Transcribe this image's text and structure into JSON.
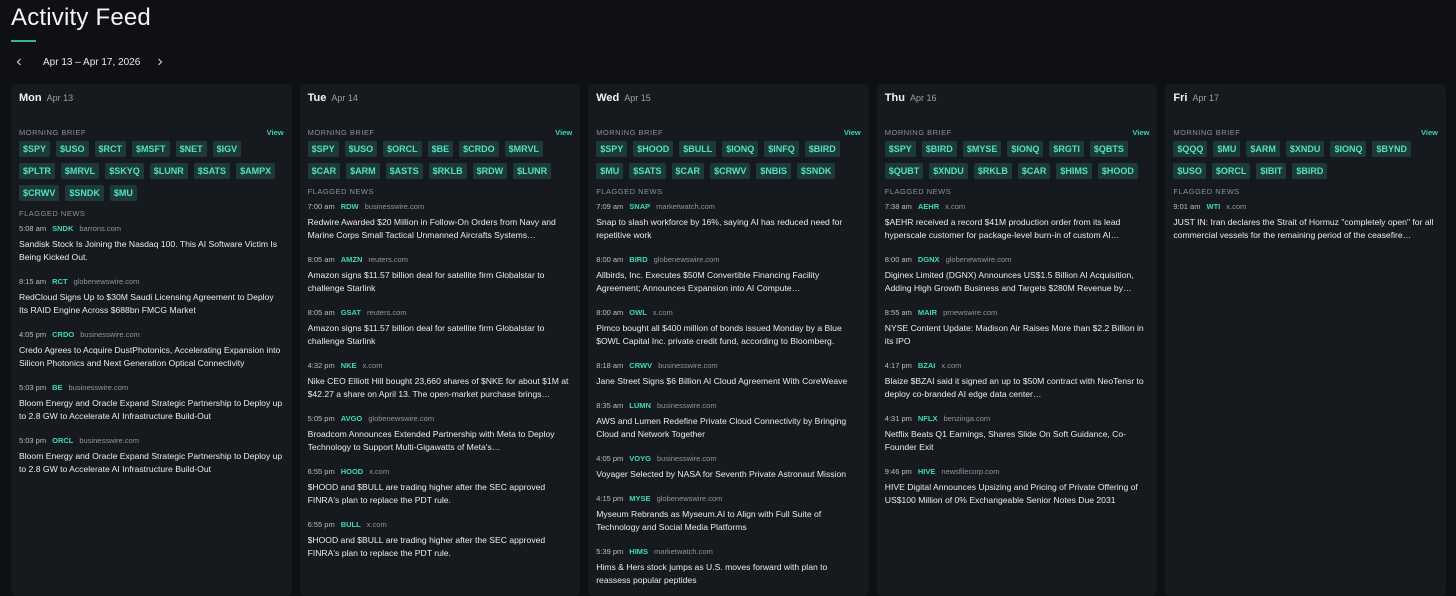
{
  "page": {
    "title": "Activity Feed"
  },
  "range": {
    "label": "Apr 13 – Apr 17, 2026"
  },
  "labels": {
    "morning_brief": "MORNING BRIEF",
    "flagged_news": "FLAGGED NEWS",
    "view": "View"
  },
  "colors": {
    "accent": "#35d6b4",
    "chip_bg": "#1d3a3b",
    "panel": "#161a1f",
    "background": "#0e1013"
  },
  "days": [
    {
      "day": "Mon",
      "date": "Apr 13",
      "tickers": [
        "$SPY",
        "$USO",
        "$RCT",
        "$MSFT",
        "$NET",
        "$IGV",
        "$PLTR",
        "$MRVL",
        "$SKYQ",
        "$LUNR",
        "$SATS",
        "$AMPX",
        "$CRWV",
        "$SNDK",
        "$MU"
      ],
      "news": [
        {
          "time": "5:08 am",
          "ticker": "SNDK",
          "source": "barrons.com",
          "text": "Sandisk Stock Is Joining the Nasdaq 100. This AI Software Victim Is Being Kicked Out."
        },
        {
          "time": "8:15 am",
          "ticker": "RCT",
          "source": "globenewswire.com",
          "text": "RedCloud Signs Up to $30M Saudi Licensing Agreement to Deploy Its RAID Engine Across $688bn FMCG Market"
        },
        {
          "time": "4:05 pm",
          "ticker": "CRDO",
          "source": "businesswire.com",
          "text": "Credo Agrees to Acquire DustPhotonics, Accelerating Expansion into Silicon Photonics and Next Generation Optical Connectivity"
        },
        {
          "time": "5:03 pm",
          "ticker": "BE",
          "source": "businesswire.com",
          "text": "Bloom Energy and Oracle Expand Strategic Partnership to Deploy up to 2.8 GW to Accelerate AI Infrastructure Build-Out"
        },
        {
          "time": "5:03 pm",
          "ticker": "ORCL",
          "source": "businesswire.com",
          "text": "Bloom Energy and Oracle Expand Strategic Partnership to Deploy up to 2.8 GW to Accelerate AI Infrastructure Build-Out"
        }
      ]
    },
    {
      "day": "Tue",
      "date": "Apr 14",
      "tickers": [
        "$SPY",
        "$USO",
        "$ORCL",
        "$BE",
        "$CRDO",
        "$MRVL",
        "$CAR",
        "$ARM",
        "$ASTS",
        "$RKLB",
        "$RDW",
        "$LUNR"
      ],
      "news": [
        {
          "time": "7:00 am",
          "ticker": "RDW",
          "source": "businesswire.com",
          "text": "Redwire Awarded $20 Million in Follow-On Orders from Navy and Marine Corps Small Tactical Unmanned Aircrafts Systems…"
        },
        {
          "time": "8:05 am",
          "ticker": "AMZN",
          "source": "reuters.com",
          "text": "Amazon signs $11.57 billion deal for satellite firm Globalstar to challenge Starlink"
        },
        {
          "time": "8:05 am",
          "ticker": "GSAT",
          "source": "reuters.com",
          "text": "Amazon signs $11.57 billion deal for satellite firm Globalstar to challenge Starlink"
        },
        {
          "time": "4:32 pm",
          "ticker": "NKE",
          "source": "x.com",
          "text": "Nike CEO Elliott Hill bought 23,660 shares of $NKE for about $1M at $42.27 a share on April 13. The open-market purchase brings…"
        },
        {
          "time": "5:05 pm",
          "ticker": "AVGO",
          "source": "globenewswire.com",
          "text": "Broadcom Announces Extended Partnership with Meta to Deploy Technology to Support Multi-Gigawatts of Meta's…"
        },
        {
          "time": "6:55 pm",
          "ticker": "HOOD",
          "source": "x.com",
          "text": "$HOOD and $BULL are trading higher after the SEC approved FINRA's plan to replace the PDT rule."
        },
        {
          "time": "6:55 pm",
          "ticker": "BULL",
          "source": "x.com",
          "text": "$HOOD and $BULL are trading higher after the SEC approved FINRA's plan to replace the PDT rule."
        }
      ]
    },
    {
      "day": "Wed",
      "date": "Apr 15",
      "tickers": [
        "$SPY",
        "$HOOD",
        "$BULL",
        "$IONQ",
        "$INFQ",
        "$BIRD",
        "$MU",
        "$SATS",
        "$CAR",
        "$CRWV",
        "$NBIS",
        "$SNDK"
      ],
      "news": [
        {
          "time": "7:09 am",
          "ticker": "SNAP",
          "source": "marketwatch.com",
          "text": "Snap to slash workforce by 16%, saying AI has reduced need for repetitive work"
        },
        {
          "time": "8:00 am",
          "ticker": "BIRD",
          "source": "globenewswire.com",
          "text": "Allbirds, Inc. Executes $50M Convertible Financing Facility Agreement; Announces Expansion into AI Compute…"
        },
        {
          "time": "8:00 am",
          "ticker": "OWL",
          "source": "x.com",
          "text": "Pimco bought all $400 million of bonds issued Monday by a Blue $OWL Capital Inc. private credit fund, according to Bloomberg."
        },
        {
          "time": "8:18 am",
          "ticker": "CRWV",
          "source": "businesswire.com",
          "text": "Jane Street Signs $6 Billion AI Cloud Agreement With CoreWeave"
        },
        {
          "time": "8:35 am",
          "ticker": "LUMN",
          "source": "businesswire.com",
          "text": "AWS and Lumen Redefine Private Cloud Connectivity by Bringing Cloud and Network Together"
        },
        {
          "time": "4:05 pm",
          "ticker": "VOYG",
          "source": "businesswire.com",
          "text": "Voyager Selected by NASA for Seventh Private Astronaut Mission"
        },
        {
          "time": "4:15 pm",
          "ticker": "MYSE",
          "source": "globenewswire.com",
          "text": "Myseum Rebrands as Myseum.AI to Align with Full Suite of Technology and Social Media Platforms"
        },
        {
          "time": "5:39 pm",
          "ticker": "HIMS",
          "source": "marketwatch.com",
          "text": "Hims & Hers stock jumps as U.S. moves forward with plan to reassess popular peptides"
        }
      ]
    },
    {
      "day": "Thu",
      "date": "Apr 16",
      "tickers": [
        "$SPY",
        "$BIRD",
        "$MYSE",
        "$IONQ",
        "$RGTI",
        "$QBTS",
        "$QUBT",
        "$XNDU",
        "$RKLB",
        "$CAR",
        "$HIMS",
        "$HOOD"
      ],
      "news": [
        {
          "time": "7:38 am",
          "ticker": "AEHR",
          "source": "x.com",
          "text": "$AEHR received a record $41M production order from its lead hyperscale customer for package-level burn-in of custom AI…"
        },
        {
          "time": "8:00 am",
          "ticker": "DGNX",
          "source": "globenewswire.com",
          "text": "Diginex Limited (DGNX) Announces US$1.5 Billion AI Acquisition, Adding High Growth Business and Targets $280M Revenue by…"
        },
        {
          "time": "8:55 am",
          "ticker": "MAIR",
          "source": "prnewswire.com",
          "text": "NYSE Content Update: Madison Air Raises More than $2.2 Billion in its IPO"
        },
        {
          "time": "4:17 pm",
          "ticker": "BZAI",
          "source": "x.com",
          "text": "Blaize $BZAI said it signed an up to $50M contract with NeoTensr to deploy co-branded AI edge data center…"
        },
        {
          "time": "4:31 pm",
          "ticker": "NFLX",
          "source": "benzinga.com",
          "text": "Netflix Beats Q1 Earnings, Shares Slide On Soft Guidance, Co-Founder Exit"
        },
        {
          "time": "9:46 pm",
          "ticker": "HIVE",
          "source": "newsfilecorp.com",
          "text": "HIVE Digital Announces Upsizing and Pricing of Private Offering of US$100 Million of 0% Exchangeable Senior Notes Due 2031"
        }
      ]
    },
    {
      "day": "Fri",
      "date": "Apr 17",
      "tickers": [
        "$QQQ",
        "$MU",
        "$ARM",
        "$XNDU",
        "$IONQ",
        "$BYND",
        "$USO",
        "$ORCL",
        "$IBIT",
        "$BIRD"
      ],
      "news": [
        {
          "time": "9:01 am",
          "ticker": "WTI",
          "source": "x.com",
          "text": "JUST IN: Iran declares the Strait of Hormuz \"completely open\" for all commercial vessels for the remaining period of the ceasefire…"
        }
      ]
    }
  ]
}
